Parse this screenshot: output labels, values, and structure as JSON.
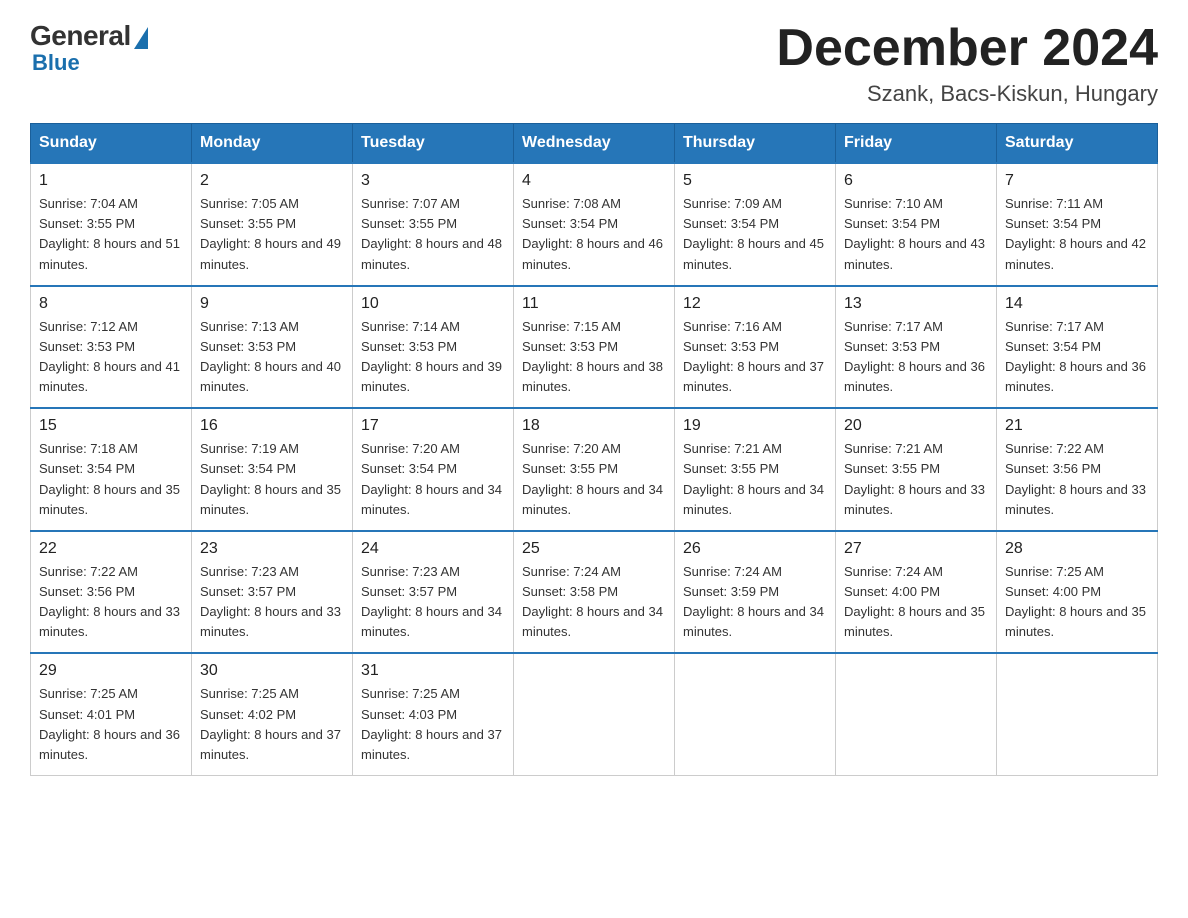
{
  "logo": {
    "general": "General",
    "blue": "Blue"
  },
  "header": {
    "month": "December 2024",
    "location": "Szank, Bacs-Kiskun, Hungary"
  },
  "weekdays": [
    "Sunday",
    "Monday",
    "Tuesday",
    "Wednesday",
    "Thursday",
    "Friday",
    "Saturday"
  ],
  "weeks": [
    [
      {
        "day": "1",
        "sunrise": "7:04 AM",
        "sunset": "3:55 PM",
        "daylight": "8 hours and 51 minutes."
      },
      {
        "day": "2",
        "sunrise": "7:05 AM",
        "sunset": "3:55 PM",
        "daylight": "8 hours and 49 minutes."
      },
      {
        "day": "3",
        "sunrise": "7:07 AM",
        "sunset": "3:55 PM",
        "daylight": "8 hours and 48 minutes."
      },
      {
        "day": "4",
        "sunrise": "7:08 AM",
        "sunset": "3:54 PM",
        "daylight": "8 hours and 46 minutes."
      },
      {
        "day": "5",
        "sunrise": "7:09 AM",
        "sunset": "3:54 PM",
        "daylight": "8 hours and 45 minutes."
      },
      {
        "day": "6",
        "sunrise": "7:10 AM",
        "sunset": "3:54 PM",
        "daylight": "8 hours and 43 minutes."
      },
      {
        "day": "7",
        "sunrise": "7:11 AM",
        "sunset": "3:54 PM",
        "daylight": "8 hours and 42 minutes."
      }
    ],
    [
      {
        "day": "8",
        "sunrise": "7:12 AM",
        "sunset": "3:53 PM",
        "daylight": "8 hours and 41 minutes."
      },
      {
        "day": "9",
        "sunrise": "7:13 AM",
        "sunset": "3:53 PM",
        "daylight": "8 hours and 40 minutes."
      },
      {
        "day": "10",
        "sunrise": "7:14 AM",
        "sunset": "3:53 PM",
        "daylight": "8 hours and 39 minutes."
      },
      {
        "day": "11",
        "sunrise": "7:15 AM",
        "sunset": "3:53 PM",
        "daylight": "8 hours and 38 minutes."
      },
      {
        "day": "12",
        "sunrise": "7:16 AM",
        "sunset": "3:53 PM",
        "daylight": "8 hours and 37 minutes."
      },
      {
        "day": "13",
        "sunrise": "7:17 AM",
        "sunset": "3:53 PM",
        "daylight": "8 hours and 36 minutes."
      },
      {
        "day": "14",
        "sunrise": "7:17 AM",
        "sunset": "3:54 PM",
        "daylight": "8 hours and 36 minutes."
      }
    ],
    [
      {
        "day": "15",
        "sunrise": "7:18 AM",
        "sunset": "3:54 PM",
        "daylight": "8 hours and 35 minutes."
      },
      {
        "day": "16",
        "sunrise": "7:19 AM",
        "sunset": "3:54 PM",
        "daylight": "8 hours and 35 minutes."
      },
      {
        "day": "17",
        "sunrise": "7:20 AM",
        "sunset": "3:54 PM",
        "daylight": "8 hours and 34 minutes."
      },
      {
        "day": "18",
        "sunrise": "7:20 AM",
        "sunset": "3:55 PM",
        "daylight": "8 hours and 34 minutes."
      },
      {
        "day": "19",
        "sunrise": "7:21 AM",
        "sunset": "3:55 PM",
        "daylight": "8 hours and 34 minutes."
      },
      {
        "day": "20",
        "sunrise": "7:21 AM",
        "sunset": "3:55 PM",
        "daylight": "8 hours and 33 minutes."
      },
      {
        "day": "21",
        "sunrise": "7:22 AM",
        "sunset": "3:56 PM",
        "daylight": "8 hours and 33 minutes."
      }
    ],
    [
      {
        "day": "22",
        "sunrise": "7:22 AM",
        "sunset": "3:56 PM",
        "daylight": "8 hours and 33 minutes."
      },
      {
        "day": "23",
        "sunrise": "7:23 AM",
        "sunset": "3:57 PM",
        "daylight": "8 hours and 33 minutes."
      },
      {
        "day": "24",
        "sunrise": "7:23 AM",
        "sunset": "3:57 PM",
        "daylight": "8 hours and 34 minutes."
      },
      {
        "day": "25",
        "sunrise": "7:24 AM",
        "sunset": "3:58 PM",
        "daylight": "8 hours and 34 minutes."
      },
      {
        "day": "26",
        "sunrise": "7:24 AM",
        "sunset": "3:59 PM",
        "daylight": "8 hours and 34 minutes."
      },
      {
        "day": "27",
        "sunrise": "7:24 AM",
        "sunset": "4:00 PM",
        "daylight": "8 hours and 35 minutes."
      },
      {
        "day": "28",
        "sunrise": "7:25 AM",
        "sunset": "4:00 PM",
        "daylight": "8 hours and 35 minutes."
      }
    ],
    [
      {
        "day": "29",
        "sunrise": "7:25 AM",
        "sunset": "4:01 PM",
        "daylight": "8 hours and 36 minutes."
      },
      {
        "day": "30",
        "sunrise": "7:25 AM",
        "sunset": "4:02 PM",
        "daylight": "8 hours and 37 minutes."
      },
      {
        "day": "31",
        "sunrise": "7:25 AM",
        "sunset": "4:03 PM",
        "daylight": "8 hours and 37 minutes."
      },
      null,
      null,
      null,
      null
    ]
  ],
  "labels": {
    "sunrise": "Sunrise:",
    "sunset": "Sunset:",
    "daylight": "Daylight:"
  }
}
